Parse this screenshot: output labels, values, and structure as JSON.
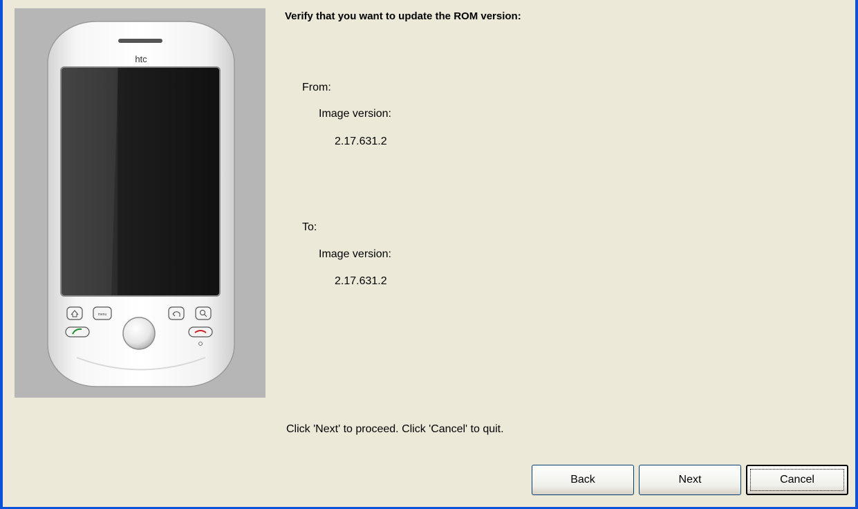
{
  "heading": "Verify that you want to update the ROM version:",
  "from": {
    "label": "From:",
    "version_label": "Image version:",
    "version_value": "2.17.631.2"
  },
  "to": {
    "label": "To:",
    "version_label": "Image version:",
    "version_value": "2.17.631.2"
  },
  "instruction": "Click 'Next' to proceed. Click 'Cancel' to quit.",
  "phone": {
    "brand": "htc",
    "menu_label": "menu"
  },
  "buttons": {
    "back": "Back",
    "next": "Next",
    "cancel": "Cancel"
  }
}
